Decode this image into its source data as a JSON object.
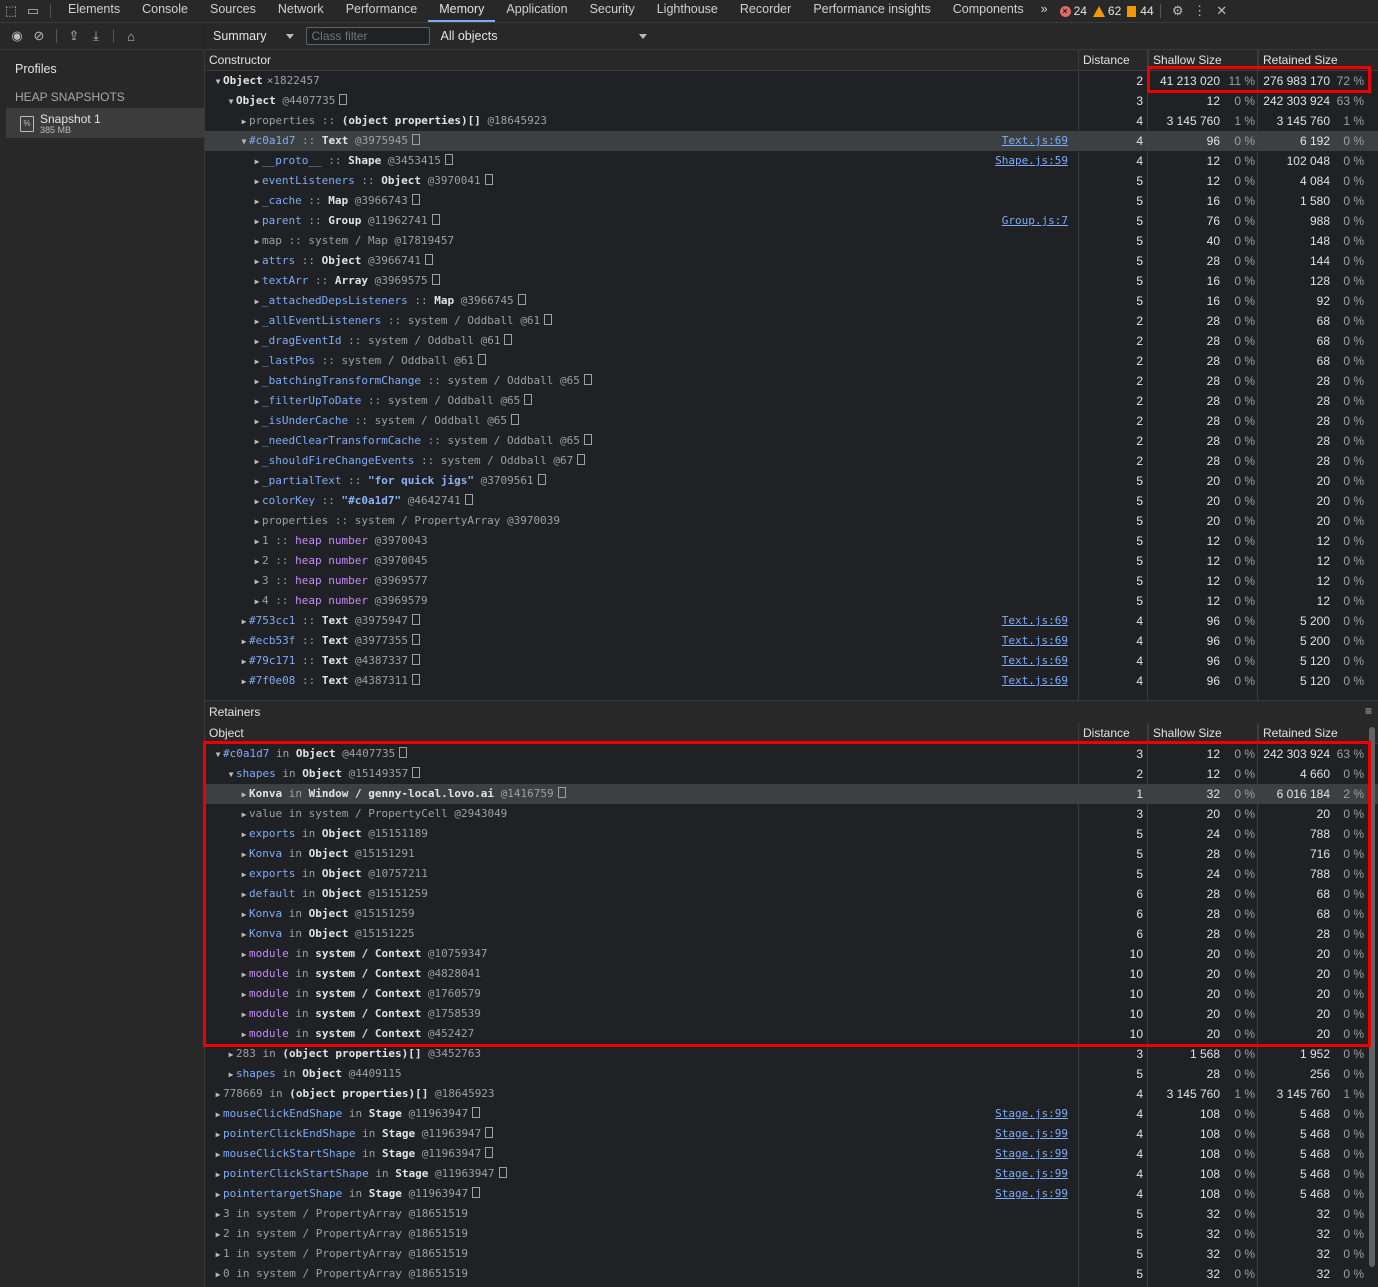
{
  "topbar": {
    "tabs": [
      "Elements",
      "Console",
      "Sources",
      "Network",
      "Performance",
      "Memory",
      "Application",
      "Security",
      "Lighthouse",
      "Recorder",
      "Performance insights",
      "Components"
    ],
    "active_tab": "Memory",
    "more": "»",
    "errors": "24",
    "warnings": "62",
    "issues": "44"
  },
  "toolbar": {
    "view_select": "Summary",
    "class_filter_placeholder": "Class filter",
    "objects_select": "All objects"
  },
  "sidebar": {
    "title": "Profiles",
    "section": "HEAP SNAPSHOTS",
    "snapshot_name": "Snapshot 1",
    "snapshot_size": "385 MB"
  },
  "summary": {
    "columns": [
      "Constructor",
      "Distance",
      "Shallow Size",
      "Retained Size"
    ],
    "rows": [
      {
        "d": 0,
        "open": true,
        "name": "Object",
        "nmc": "ty",
        "count": "×1822457",
        "dist": "2",
        "shn": "41 213 020",
        "shp": "11 %",
        "ren": "276 983 170",
        "rep": "72 %"
      },
      {
        "d": 1,
        "open": true,
        "name": "Object",
        "nmc": "ty",
        "id": "@4407735",
        "box": true,
        "dist": "3",
        "shn": "12",
        "shp": "0 %",
        "ren": "242 303 924",
        "rep": "63 %"
      },
      {
        "d": 2,
        "name": "properties",
        "nmc": "gray",
        "type": "(object properties)[]",
        "id": "@18645923",
        "dist": "4",
        "shn": "3 145 760",
        "shp": "1 %",
        "ren": "3 145 760",
        "rep": "1 %"
      },
      {
        "d": 2,
        "open": true,
        "sel": true,
        "name": "#c0a1d7",
        "nmc": "blue",
        "type": "Text",
        "id": "@3975945",
        "box": true,
        "link": "Text.js:69",
        "dist": "4",
        "shn": "96",
        "shp": "0 %",
        "ren": "6 192",
        "rep": "0 %"
      },
      {
        "d": 3,
        "name": "__proto__",
        "nmc": "blue",
        "type": "Shape",
        "id": "@3453415",
        "box": true,
        "link": "Shape.js:59",
        "dist": "4",
        "shn": "12",
        "shp": "0 %",
        "ren": "102 048",
        "rep": "0 %"
      },
      {
        "d": 3,
        "name": "eventListeners",
        "nmc": "blue",
        "type": "Object",
        "id": "@3970041",
        "box": true,
        "dist": "5",
        "shn": "12",
        "shp": "0 %",
        "ren": "4 084",
        "rep": "0 %"
      },
      {
        "d": 3,
        "name": "_cache",
        "nmc": "blue",
        "type": "Map",
        "id": "@3966743",
        "box": true,
        "dist": "5",
        "shn": "16",
        "shp": "0 %",
        "ren": "1 580",
        "rep": "0 %"
      },
      {
        "d": 3,
        "name": "parent",
        "nmc": "blue",
        "type": "Group",
        "id": "@11962741",
        "box": true,
        "link": "Group.js:7",
        "dist": "5",
        "shn": "76",
        "shp": "0 %",
        "ren": "988",
        "rep": "0 %"
      },
      {
        "d": 3,
        "name": "map",
        "nmc": "gray",
        "sys": "system / Map",
        "id": "@17819457",
        "dist": "5",
        "shn": "40",
        "shp": "0 %",
        "ren": "148",
        "rep": "0 %"
      },
      {
        "d": 3,
        "name": "attrs",
        "nmc": "blue",
        "type": "Object",
        "id": "@3966741",
        "box": true,
        "dist": "5",
        "shn": "28",
        "shp": "0 %",
        "ren": "144",
        "rep": "0 %"
      },
      {
        "d": 3,
        "name": "textArr",
        "nmc": "blue",
        "type": "Array",
        "id": "@3969575",
        "box": true,
        "dist": "5",
        "shn": "16",
        "shp": "0 %",
        "ren": "128",
        "rep": "0 %"
      },
      {
        "d": 3,
        "name": "_attachedDepsListeners",
        "nmc": "blue",
        "type": "Map",
        "id": "@3966745",
        "box": true,
        "dist": "5",
        "shn": "16",
        "shp": "0 %",
        "ren": "92",
        "rep": "0 %"
      },
      {
        "d": 3,
        "name": "_allEventListeners",
        "nmc": "blue",
        "sys": "system / Oddball",
        "id": "@61",
        "box": true,
        "dist": "2",
        "shn": "28",
        "shp": "0 %",
        "ren": "68",
        "rep": "0 %"
      },
      {
        "d": 3,
        "name": "_dragEventId",
        "nmc": "blue",
        "sys": "system / Oddball",
        "id": "@61",
        "box": true,
        "dist": "2",
        "shn": "28",
        "shp": "0 %",
        "ren": "68",
        "rep": "0 %"
      },
      {
        "d": 3,
        "name": "_lastPos",
        "nmc": "blue",
        "sys": "system / Oddball",
        "id": "@61",
        "box": true,
        "dist": "2",
        "shn": "28",
        "shp": "0 %",
        "ren": "68",
        "rep": "0 %"
      },
      {
        "d": 3,
        "name": "_batchingTransformChange",
        "nmc": "blue",
        "sys": "system / Oddball",
        "id": "@65",
        "box": true,
        "dist": "2",
        "shn": "28",
        "shp": "0 %",
        "ren": "28",
        "rep": "0 %"
      },
      {
        "d": 3,
        "name": "_filterUpToDate",
        "nmc": "blue",
        "sys": "system / Oddball",
        "id": "@65",
        "box": true,
        "dist": "2",
        "shn": "28",
        "shp": "0 %",
        "ren": "28",
        "rep": "0 %"
      },
      {
        "d": 3,
        "name": "_isUnderCache",
        "nmc": "blue",
        "sys": "system / Oddball",
        "id": "@65",
        "box": true,
        "dist": "2",
        "shn": "28",
        "shp": "0 %",
        "ren": "28",
        "rep": "0 %"
      },
      {
        "d": 3,
        "name": "_needClearTransformCache",
        "nmc": "blue",
        "sys": "system / Oddball",
        "id": "@65",
        "box": true,
        "dist": "2",
        "shn": "28",
        "shp": "0 %",
        "ren": "28",
        "rep": "0 %"
      },
      {
        "d": 3,
        "name": "_shouldFireChangeEvents",
        "nmc": "blue",
        "sys": "system / Oddball",
        "id": "@67",
        "box": true,
        "dist": "2",
        "shn": "28",
        "shp": "0 %",
        "ren": "28",
        "rep": "0 %"
      },
      {
        "d": 3,
        "name": "_partialText",
        "nmc": "blue",
        "str": "\"for quick jigs\"",
        "id": "@3709561",
        "box": true,
        "dist": "5",
        "shn": "20",
        "shp": "0 %",
        "ren": "20",
        "rep": "0 %"
      },
      {
        "d": 3,
        "name": "colorKey",
        "nmc": "blue",
        "str": "\"#c0a1d7\"",
        "id": "@4642741",
        "box": true,
        "dist": "5",
        "shn": "20",
        "shp": "0 %",
        "ren": "20",
        "rep": "0 %"
      },
      {
        "d": 3,
        "name": "properties",
        "nmc": "gray",
        "sys": "system / PropertyArray",
        "id": "@3970039",
        "dist": "5",
        "shn": "20",
        "shp": "0 %",
        "ren": "20",
        "rep": "0 %"
      },
      {
        "d": 3,
        "name": "1",
        "nmc": "gray",
        "heap": "heap number",
        "id": "@3970043",
        "dist": "5",
        "shn": "12",
        "shp": "0 %",
        "ren": "12",
        "rep": "0 %"
      },
      {
        "d": 3,
        "name": "2",
        "nmc": "gray",
        "heap": "heap number",
        "id": "@3970045",
        "dist": "5",
        "shn": "12",
        "shp": "0 %",
        "ren": "12",
        "rep": "0 %"
      },
      {
        "d": 3,
        "name": "3",
        "nmc": "gray",
        "heap": "heap number",
        "id": "@3969577",
        "dist": "5",
        "shn": "12",
        "shp": "0 %",
        "ren": "12",
        "rep": "0 %"
      },
      {
        "d": 3,
        "name": "4",
        "nmc": "gray",
        "heap": "heap number",
        "id": "@3969579",
        "dist": "5",
        "shn": "12",
        "shp": "0 %",
        "ren": "12",
        "rep": "0 %"
      },
      {
        "d": 2,
        "name": "#753cc1",
        "nmc": "blue",
        "type": "Text",
        "id": "@3975947",
        "box": true,
        "link": "Text.js:69",
        "dist": "4",
        "shn": "96",
        "shp": "0 %",
        "ren": "5 200",
        "rep": "0 %"
      },
      {
        "d": 2,
        "name": "#ecb53f",
        "nmc": "blue",
        "type": "Text",
        "id": "@3977355",
        "box": true,
        "link": "Text.js:69",
        "dist": "4",
        "shn": "96",
        "shp": "0 %",
        "ren": "5 200",
        "rep": "0 %"
      },
      {
        "d": 2,
        "name": "#79c171",
        "nmc": "blue",
        "type": "Text",
        "id": "@4387337",
        "box": true,
        "link": "Text.js:69",
        "dist": "4",
        "shn": "96",
        "shp": "0 %",
        "ren": "5 120",
        "rep": "0 %"
      },
      {
        "d": 2,
        "name": "#7f0e08",
        "nmc": "blue",
        "type": "Text",
        "id": "@4387311",
        "box": true,
        "link": "Text.js:69",
        "dist": "4",
        "shn": "96",
        "shp": "0 %",
        "ren": "5 120",
        "rep": "0 %"
      }
    ]
  },
  "retainers": {
    "title": "Retainers",
    "columns": [
      "Object",
      "Distance",
      "Shallow Size",
      "Retained Size"
    ],
    "rows": [
      {
        "d": 0,
        "open": true,
        "name": "#c0a1d7",
        "nmc": "blue",
        "in": "Object",
        "id": "@4407735",
        "box": true,
        "dist": "3",
        "shn": "12",
        "shp": "0 %",
        "ren": "242 303 924",
        "rep": "63 %"
      },
      {
        "d": 1,
        "open": true,
        "name": "shapes",
        "nmc": "blue",
        "in": "Object",
        "id": "@15149357",
        "box": true,
        "dist": "2",
        "shn": "12",
        "shp": "0 %",
        "ren": "4 660",
        "rep": "0 %"
      },
      {
        "d": 2,
        "sel": true,
        "name": "Konva",
        "nmc": "ty",
        "in": "Window / genny-local.lovo.ai",
        "id": "@1416759",
        "box": true,
        "dist": "1",
        "shn": "32",
        "shp": "0 %",
        "ren": "6 016 184",
        "rep": "2 %"
      },
      {
        "d": 2,
        "name": "value",
        "nmc": "gray",
        "insys": "system / PropertyCell",
        "id": "@2943049",
        "dist": "3",
        "shn": "20",
        "shp": "0 %",
        "ren": "20",
        "rep": "0 %"
      },
      {
        "d": 2,
        "name": "exports",
        "nmc": "blue",
        "in": "Object",
        "id": "@15151189",
        "dist": "5",
        "shn": "24",
        "shp": "0 %",
        "ren": "788",
        "rep": "0 %"
      },
      {
        "d": 2,
        "name": "Konva",
        "nmc": "blue",
        "in": "Object",
        "id": "@15151291",
        "dist": "5",
        "shn": "28",
        "shp": "0 %",
        "ren": "716",
        "rep": "0 %"
      },
      {
        "d": 2,
        "name": "exports",
        "nmc": "blue",
        "in": "Object",
        "id": "@10757211",
        "dist": "5",
        "shn": "24",
        "shp": "0 %",
        "ren": "788",
        "rep": "0 %"
      },
      {
        "d": 2,
        "name": "default",
        "nmc": "blue",
        "in": "Object",
        "id": "@15151259",
        "dist": "6",
        "shn": "28",
        "shp": "0 %",
        "ren": "68",
        "rep": "0 %"
      },
      {
        "d": 2,
        "name": "Konva",
        "nmc": "blue",
        "in": "Object",
        "id": "@15151259",
        "dist": "6",
        "shn": "28",
        "shp": "0 %",
        "ren": "68",
        "rep": "0 %"
      },
      {
        "d": 2,
        "name": "Konva",
        "nmc": "blue",
        "in": "Object",
        "id": "@15151225",
        "dist": "6",
        "shn": "28",
        "shp": "0 %",
        "ren": "28",
        "rep": "0 %"
      },
      {
        "d": 2,
        "name": "module",
        "nmc": "purple",
        "in": "system / Context",
        "id": "@10759347",
        "dist": "10",
        "shn": "20",
        "shp": "0 %",
        "ren": "20",
        "rep": "0 %"
      },
      {
        "d": 2,
        "name": "module",
        "nmc": "purple",
        "in": "system / Context",
        "id": "@4828041",
        "dist": "10",
        "shn": "20",
        "shp": "0 %",
        "ren": "20",
        "rep": "0 %"
      },
      {
        "d": 2,
        "name": "module",
        "nmc": "purple",
        "in": "system / Context",
        "id": "@1760579",
        "dist": "10",
        "shn": "20",
        "shp": "0 %",
        "ren": "20",
        "rep": "0 %"
      },
      {
        "d": 2,
        "name": "module",
        "nmc": "purple",
        "in": "system / Context",
        "id": "@1758539",
        "dist": "10",
        "shn": "20",
        "shp": "0 %",
        "ren": "20",
        "rep": "0 %"
      },
      {
        "d": 2,
        "name": "module",
        "nmc": "purple",
        "in": "system / Context",
        "id": "@452427",
        "dist": "10",
        "shn": "20",
        "shp": "0 %",
        "ren": "20",
        "rep": "0 %"
      },
      {
        "d": 1,
        "name": "283",
        "nmc": "gray",
        "in": "(object properties)[]",
        "id": "@3452763",
        "dist": "3",
        "shn": "1 568",
        "shp": "0 %",
        "ren": "1 952",
        "rep": "0 %"
      },
      {
        "d": 1,
        "name": "shapes",
        "nmc": "blue",
        "in": "Object",
        "id": "@4409115",
        "dist": "5",
        "shn": "28",
        "shp": "0 %",
        "ren": "256",
        "rep": "0 %"
      },
      {
        "d": 0,
        "name": "778669",
        "nmc": "gray",
        "in": "(object properties)[]",
        "id": "@18645923",
        "dist": "4",
        "shn": "3 145 760",
        "shp": "1 %",
        "ren": "3 145 760",
        "rep": "1 %"
      },
      {
        "d": 0,
        "name": "mouseClickEndShape",
        "nmc": "blue",
        "in": "Stage",
        "id": "@11963947",
        "box": true,
        "link": "Stage.js:99",
        "dist": "4",
        "shn": "108",
        "shp": "0 %",
        "ren": "5 468",
        "rep": "0 %"
      },
      {
        "d": 0,
        "name": "pointerClickEndShape",
        "nmc": "blue",
        "in": "Stage",
        "id": "@11963947",
        "box": true,
        "link": "Stage.js:99",
        "dist": "4",
        "shn": "108",
        "shp": "0 %",
        "ren": "5 468",
        "rep": "0 %"
      },
      {
        "d": 0,
        "name": "mouseClickStartShape",
        "nmc": "blue",
        "in": "Stage",
        "id": "@11963947",
        "box": true,
        "link": "Stage.js:99",
        "dist": "4",
        "shn": "108",
        "shp": "0 %",
        "ren": "5 468",
        "rep": "0 %"
      },
      {
        "d": 0,
        "name": "pointerClickStartShape",
        "nmc": "blue",
        "in": "Stage",
        "id": "@11963947",
        "box": true,
        "link": "Stage.js:99",
        "dist": "4",
        "shn": "108",
        "shp": "0 %",
        "ren": "5 468",
        "rep": "0 %"
      },
      {
        "d": 0,
        "name": "pointertargetShape",
        "nmc": "blue",
        "in": "Stage",
        "id": "@11963947",
        "box": true,
        "link": "Stage.js:99",
        "dist": "4",
        "shn": "108",
        "shp": "0 %",
        "ren": "5 468",
        "rep": "0 %"
      },
      {
        "d": 0,
        "name": "3",
        "nmc": "gray",
        "insys": "system / PropertyArray",
        "id": "@18651519",
        "dist": "5",
        "shn": "32",
        "shp": "0 %",
        "ren": "32",
        "rep": "0 %"
      },
      {
        "d": 0,
        "name": "2",
        "nmc": "gray",
        "insys": "system / PropertyArray",
        "id": "@18651519",
        "dist": "5",
        "shn": "32",
        "shp": "0 %",
        "ren": "32",
        "rep": "0 %"
      },
      {
        "d": 0,
        "name": "1",
        "nmc": "gray",
        "insys": "system / PropertyArray",
        "id": "@18651519",
        "dist": "5",
        "shn": "32",
        "shp": "0 %",
        "ren": "32",
        "rep": "0 %"
      },
      {
        "d": 0,
        "name": "0",
        "nmc": "gray",
        "insys": "system / PropertyArray",
        "id": "@18651519",
        "dist": "5",
        "shn": "32",
        "shp": "0 %",
        "ren": "32",
        "rep": "0 %"
      }
    ]
  },
  "colors": {
    "highlight_box": "#ee0000",
    "link": "#7cacf8",
    "purple": "#c58af9"
  }
}
